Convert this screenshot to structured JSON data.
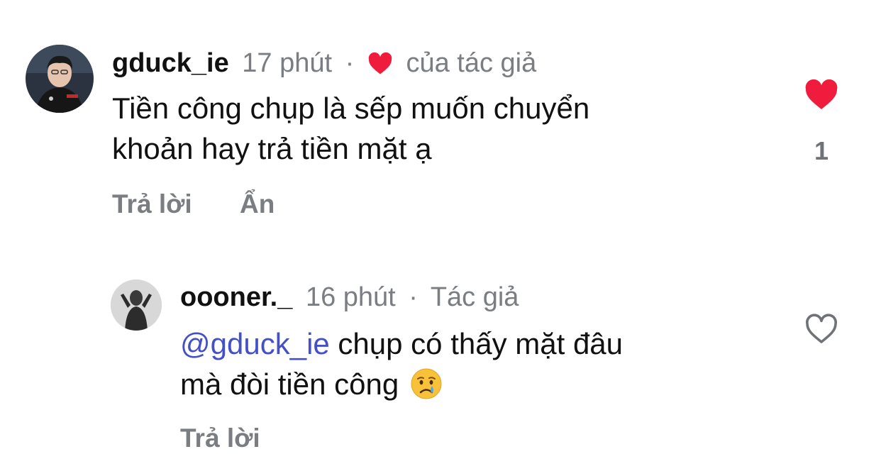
{
  "comments": [
    {
      "username": "gduck_ie",
      "time": "17 phút",
      "separator": "·",
      "badge": "của tác giả",
      "badge_icon": "red-heart-icon",
      "text_line1": "Tiền công chụp là sếp muốn chuyển",
      "text_line2": "khoản hay trả tiền mặt ạ",
      "liked": true,
      "like_count": "1",
      "actions": {
        "reply": "Trả lời",
        "hide": "Ẩn"
      }
    },
    {
      "username": "oooner._",
      "time": "16 phút",
      "separator": "·",
      "badge": "Tác giả",
      "mention": "@gduck_ie",
      "text_line1_rest": " chụp có thấy mặt đâu",
      "text_line2": "mà đòi tiền công",
      "emoji": "crying-face-emoji",
      "liked": false,
      "actions": {
        "reply": "Trả lời"
      }
    }
  ],
  "colors": {
    "text": "#111111",
    "secondary": "#7a7d82",
    "heart": "#ef1c3e",
    "mention": "#4450c8"
  }
}
